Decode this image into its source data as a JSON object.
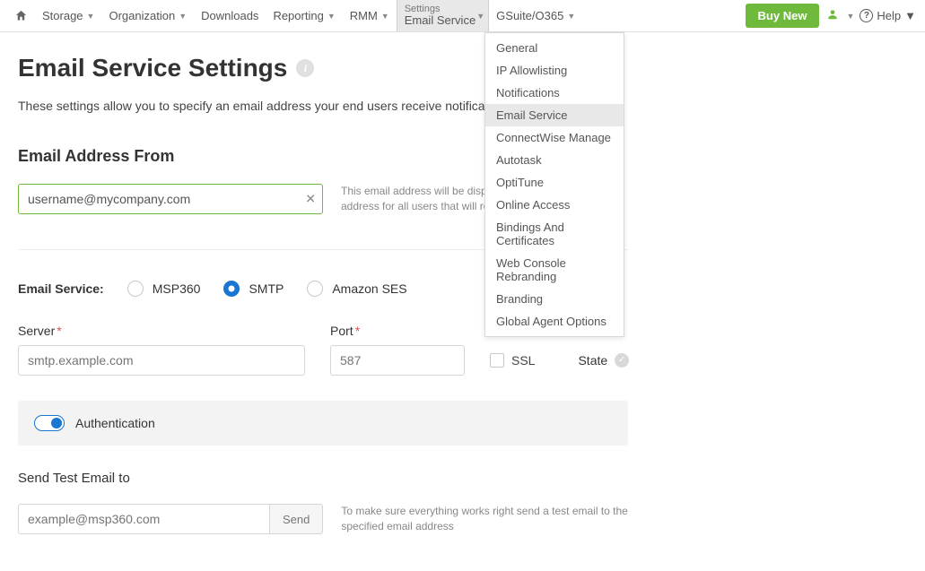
{
  "nav": {
    "storage": "Storage",
    "organization": "Organization",
    "downloads": "Downloads",
    "reporting": "Reporting",
    "rmm": "RMM",
    "settings_top": "Settings",
    "settings_sub": "Email Service",
    "gsuite": "GSuite/O365",
    "buy": "Buy New",
    "help": "Help"
  },
  "dropdown": {
    "items": [
      "General",
      "IP Allowlisting",
      "Notifications",
      "Email Service",
      "ConnectWise Manage",
      "Autotask",
      "OptiTune",
      "Online Access",
      "Bindings And Certificates",
      "Web Console Rebranding",
      "Branding",
      "Global Agent Options"
    ],
    "active_index": 3
  },
  "page": {
    "title": "Email Service Settings",
    "intro": "These settings allow you to specify an email address your end users receive notifications from"
  },
  "email_from": {
    "section": "Email Address From",
    "value": "username@mycompany.com",
    "hint": "This email address will be displayed as the sender email address for all users that will receive notifications"
  },
  "service": {
    "label": "Email Service:",
    "opt1": "MSP360",
    "opt2": "SMTP",
    "opt3": "Amazon SES",
    "selected": "SMTP"
  },
  "smtp": {
    "server_label": "Server",
    "server_ph": "smtp.example.com",
    "port_label": "Port",
    "port_ph": "587",
    "ssl_label": "SSL",
    "state_label": "State"
  },
  "auth": {
    "label": "Authentication"
  },
  "test": {
    "section": "Send Test Email to",
    "placeholder": "example@msp360.com",
    "send": "Send",
    "hint": "To make sure everything works right send a test email to the specified email address"
  }
}
